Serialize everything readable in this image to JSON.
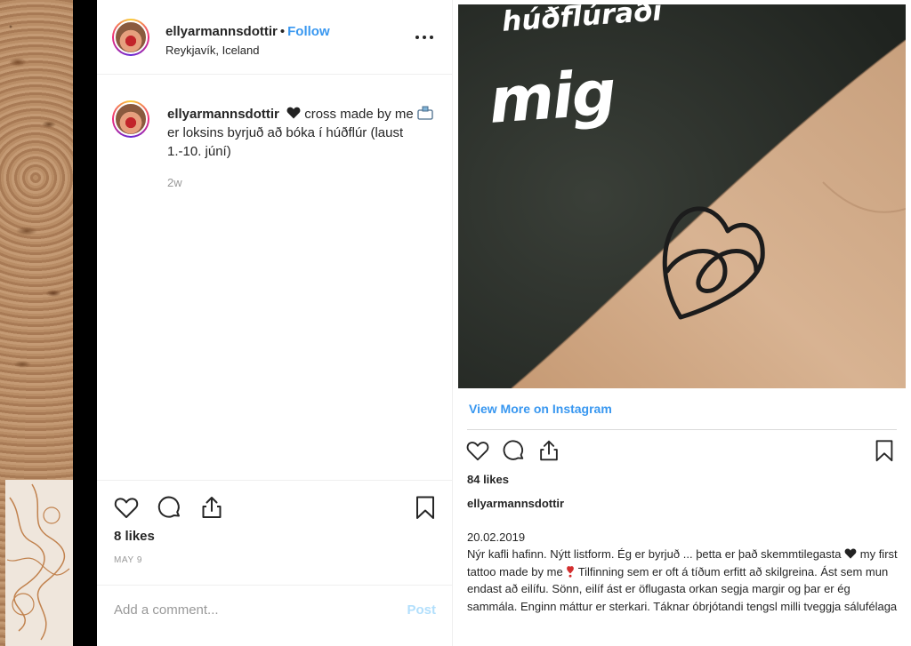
{
  "left_post": {
    "username": "ellyarmannsdottir",
    "separator": "•",
    "follow_label": "Follow",
    "location": "Reykjavík, Iceland",
    "caption_part1": "cross made by me",
    "caption_part2": "er loksins byrjuð að bóka í húðflúr (laust 1.-10. júní)",
    "time_ago": "2w",
    "likes": "8 likes",
    "date": "MAY 9",
    "comment_placeholder": "Add a comment...",
    "post_label": "Post"
  },
  "right_embed": {
    "story_text_line1": "húðflúraði",
    "story_text_line2": "mig",
    "view_more_label": "View More on Instagram",
    "likes": "84 likes",
    "username": "ellyarmannsdottir",
    "date": "20.02.2019",
    "body_part1": "Nýr kafli hafinn. Nýtt listform. Ég er byrjuð ... þetta er það skemmtilegasta",
    "body_part2": "my first tattoo made by me",
    "body_part3": "Tilfinning sem er oft á tíðum erfitt að skilgreina. Ást sem mun endast að eilífu. Sönn, eilíf ást er öflugasta orkan segja margir og þar er ég sammála. Enginn máttur er sterkari. Táknar óbrjótandi tengsl milli tveggja sálufélaga"
  },
  "colors": {
    "link_blue": "#3897f0",
    "post_disabled": "#b2dffc",
    "muted_text": "#999999",
    "text": "#262626"
  },
  "icons": [
    "more-icon",
    "heart-icon",
    "comment-icon",
    "share-icon",
    "bookmark-icon",
    "black-heart-emoji",
    "box-emoji",
    "red-exclamation-emoji"
  ]
}
